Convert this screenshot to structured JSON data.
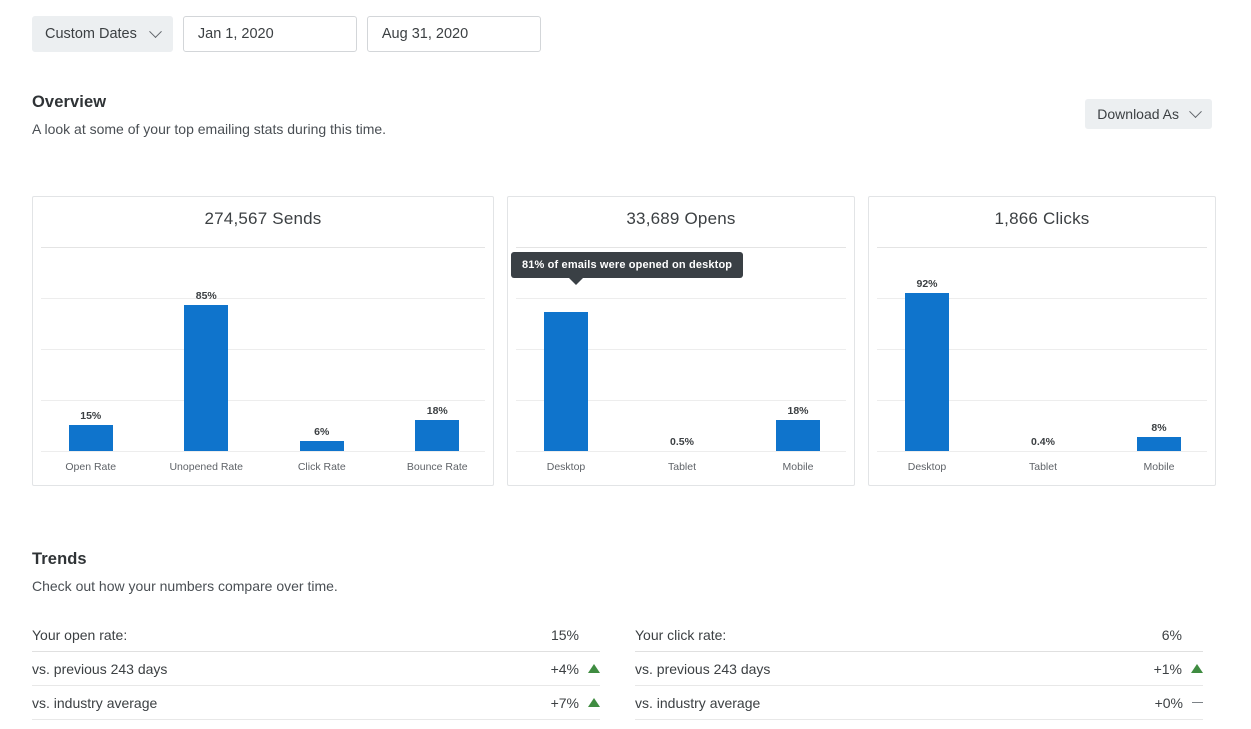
{
  "datebar": {
    "range_preset": "Custom Dates",
    "caret_icon": "chevron-down-icon",
    "start_date": "Jan 1, 2020",
    "end_date": "Aug 31, 2020"
  },
  "overview": {
    "title": "Overview",
    "subtitle": "A look at some of your top emailing stats during this time.",
    "download_label": "Download As",
    "download_caret_icon": "chevron-down-icon"
  },
  "trends": {
    "title": "Trends",
    "subtitle": "Check out how your numbers compare over time.",
    "tables": [
      {
        "rows": [
          {
            "label": "Your open rate:",
            "value": "15%",
            "indicator": "none"
          },
          {
            "label": "vs. previous 243 days",
            "value": "+4%",
            "indicator": "up"
          },
          {
            "label": "vs. industry average",
            "value": "+7%",
            "indicator": "up"
          }
        ]
      },
      {
        "rows": [
          {
            "label": "Your click rate:",
            "value": "6%",
            "indicator": "none"
          },
          {
            "label": "vs. previous 243 days",
            "value": "+1%",
            "indicator": "up"
          },
          {
            "label": "vs. industry average",
            "value": "+0%",
            "indicator": "flat"
          }
        ]
      }
    ]
  },
  "colors": {
    "bar_blue": "#0f74cc",
    "tooltip_bg": "#3a4045",
    "trend_up_green": "#3f8c41",
    "trend_flat_gray": "#7c8287",
    "chip_bg": "#eceff1"
  },
  "tooltip": {
    "text": "81% of emails were opened on desktop"
  },
  "chart_data": [
    {
      "type": "bar",
      "title": "274,567 Sends",
      "categories": [
        "Open Rate",
        "Unopened Rate",
        "Click Rate",
        "Bounce Rate"
      ],
      "values": [
        15,
        85,
        6,
        18
      ],
      "value_labels": [
        "15%",
        "6%",
        "85%",
        "18%"
      ],
      "display_labels": [
        "15%",
        "85%",
        "6%",
        "18%"
      ],
      "xlabel": "",
      "ylabel": "",
      "ylim": [
        0,
        100
      ],
      "grid": true,
      "legend": false
    },
    {
      "type": "bar",
      "title": "33,689 Opens",
      "categories": [
        "Desktop",
        "Tablet",
        "Mobile"
      ],
      "values": [
        81,
        0.5,
        18
      ],
      "display_labels": [
        "",
        "0.5%",
        "18%"
      ],
      "tooltip": "81% of emails were opened on desktop",
      "xlabel": "",
      "ylabel": "",
      "ylim": [
        0,
        100
      ],
      "grid": true,
      "legend": false
    },
    {
      "type": "bar",
      "title": "1,866 Clicks",
      "categories": [
        "Desktop",
        "Tablet",
        "Mobile"
      ],
      "values": [
        92,
        0.4,
        8
      ],
      "display_labels": [
        "92%",
        "0.4%",
        "8%"
      ],
      "xlabel": "",
      "ylabel": "",
      "ylim": [
        0,
        100
      ],
      "grid": true,
      "legend": false
    }
  ]
}
